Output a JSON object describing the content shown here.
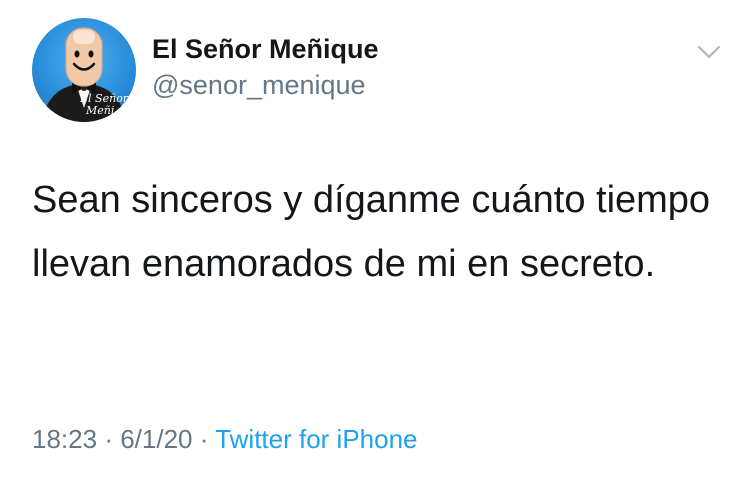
{
  "author": {
    "display_name": "El Señor Meñique",
    "handle": "@senor_menique",
    "avatar_caption_line1": "El Señor",
    "avatar_caption_line2": "Meñi"
  },
  "tweet": {
    "text": "Sean sinceros y díganme cuánto tiempo llevan enamorados de mi en secreto."
  },
  "meta": {
    "time": "18:23",
    "separator": "·",
    "date": "6/1/20",
    "source": "Twitter for iPhone"
  },
  "icons": {
    "menu": "chevron-down-icon",
    "avatar": "avatar-icon"
  },
  "colors": {
    "text": "#14171a",
    "secondary": "#657786",
    "link": "#1da1f2",
    "avatar_bg": "#2a8fdc"
  }
}
